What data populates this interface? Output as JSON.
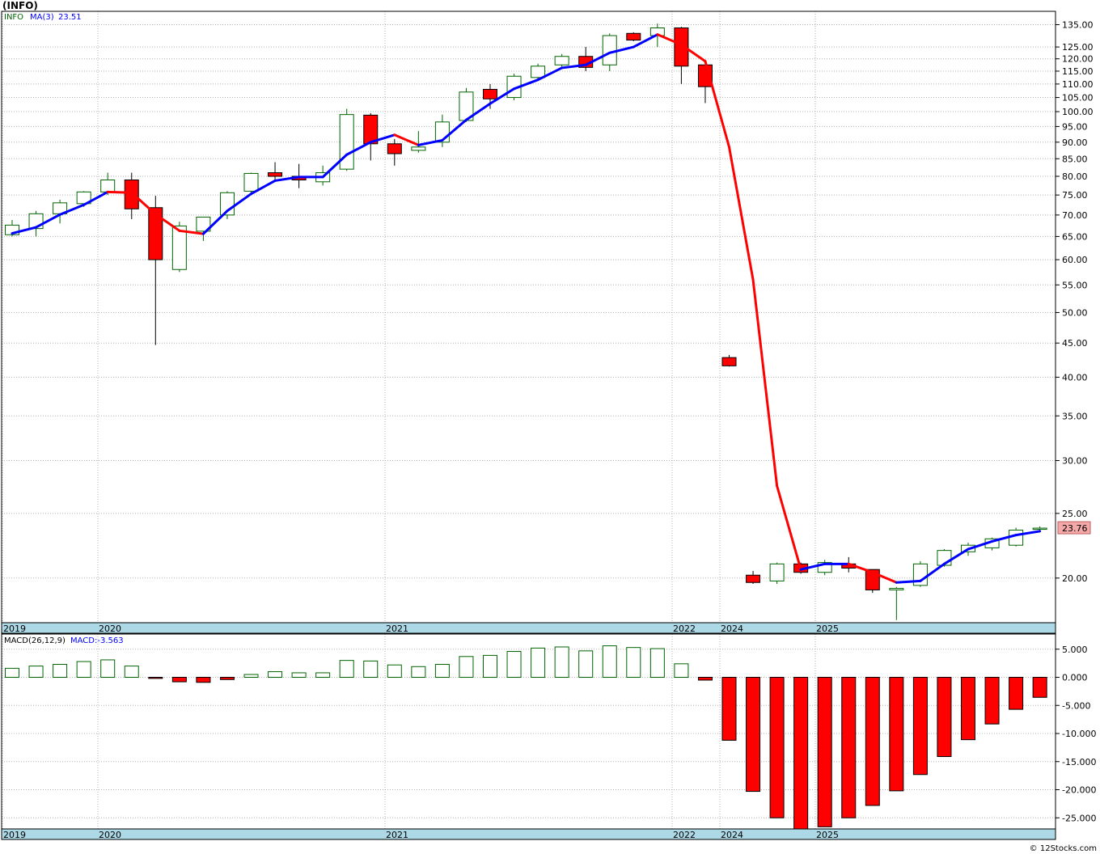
{
  "title": "(INFO)",
  "watermark": "© 12Stocks.com",
  "colors": {
    "up": "#006400",
    "down": "#ff0000",
    "ma_up": "#0000ff",
    "ma_down": "#ff0000",
    "axis_bar": "#add8e6",
    "grid": "#b0b0b0",
    "price_box": "#f4a8a8"
  },
  "chart_data": [
    {
      "type": "candlestick",
      "legend": {
        "symbol": "INFO",
        "ma_label": "MA(3)",
        "ma_value": "23.51"
      },
      "y_scale": "log",
      "ylim": [
        17.3,
        139
      ],
      "y_ticks": [
        "135.00",
        "125.00",
        "120.00",
        "115.00",
        "110.00",
        "105.00",
        "100.00",
        "95.00",
        "90.00",
        "85.00",
        "80.00",
        "75.00",
        "70.00",
        "65.00",
        "60.00",
        "55.00",
        "50.00",
        "45.00",
        "40.00",
        "35.00",
        "30.00",
        "25.00",
        "20.00"
      ],
      "year_labels": [
        "2019",
        "2020",
        "2021",
        "2022",
        "2024",
        "2025"
      ],
      "last_price": "23.76",
      "candles": [
        {
          "o": 65.4,
          "h": 68.8,
          "l": 65.0,
          "c": 67.6
        },
        {
          "o": 66.8,
          "h": 71.0,
          "l": 65.0,
          "c": 70.3
        },
        {
          "o": 70.3,
          "h": 73.8,
          "l": 68.0,
          "c": 73.0
        },
        {
          "o": 72.8,
          "h": 76.0,
          "l": 72.0,
          "c": 75.8
        },
        {
          "o": 75.8,
          "h": 81.0,
          "l": 75.0,
          "c": 79.0
        },
        {
          "o": 79.0,
          "h": 81.0,
          "l": 69.0,
          "c": 71.5
        },
        {
          "o": 71.8,
          "h": 74.8,
          "l": 44.7,
          "c": 60.0
        },
        {
          "o": 58.0,
          "h": 68.4,
          "l": 57.5,
          "c": 67.4
        },
        {
          "o": 66.2,
          "h": 69.5,
          "l": 64.0,
          "c": 69.5
        },
        {
          "o": 70.0,
          "h": 76.0,
          "l": 69.0,
          "c": 75.6
        },
        {
          "o": 76.0,
          "h": 81.0,
          "l": 75.5,
          "c": 80.8
        },
        {
          "o": 81.0,
          "h": 84.0,
          "l": 79.0,
          "c": 80.0
        },
        {
          "o": 80.0,
          "h": 83.5,
          "l": 76.8,
          "c": 79.0
        },
        {
          "o": 78.5,
          "h": 83.0,
          "l": 77.5,
          "c": 81.0
        },
        {
          "o": 82.0,
          "h": 101.0,
          "l": 81.5,
          "c": 99.0
        },
        {
          "o": 98.8,
          "h": 99.5,
          "l": 84.5,
          "c": 89.5
        },
        {
          "o": 89.5,
          "h": 91.0,
          "l": 83.0,
          "c": 86.5
        },
        {
          "o": 87.5,
          "h": 93.5,
          "l": 86.8,
          "c": 88.5
        },
        {
          "o": 90.0,
          "h": 99.0,
          "l": 88.5,
          "c": 96.5
        },
        {
          "o": 97.0,
          "h": 108.5,
          "l": 96.5,
          "c": 107.0
        },
        {
          "o": 108.0,
          "h": 110.0,
          "l": 101.0,
          "c": 104.5
        },
        {
          "o": 105.0,
          "h": 114.0,
          "l": 104.0,
          "c": 113.0
        },
        {
          "o": 112.5,
          "h": 118.0,
          "l": 112.0,
          "c": 117.0
        },
        {
          "o": 117.5,
          "h": 122.0,
          "l": 116.0,
          "c": 121.0
        },
        {
          "o": 121.0,
          "h": 125.0,
          "l": 115.0,
          "c": 116.5
        },
        {
          "o": 117.5,
          "h": 131.0,
          "l": 115.0,
          "c": 130.0
        },
        {
          "o": 131.0,
          "h": 131.5,
          "l": 127.5,
          "c": 128.0
        },
        {
          "o": 130.0,
          "h": 135.5,
          "l": 125.0,
          "c": 133.5
        },
        {
          "o": 133.5,
          "h": 134.0,
          "l": 110.0,
          "c": 117.0
        },
        {
          "o": 117.5,
          "h": 118.5,
          "l": 103.0,
          "c": 109.0
        },
        {
          "o": 42.8,
          "h": 43.2,
          "l": 41.5,
          "c": 41.6
        },
        {
          "o": 20.2,
          "h": 20.5,
          "l": 19.6,
          "c": 19.7
        },
        {
          "o": 19.8,
          "h": 21.1,
          "l": 19.6,
          "c": 21.0
        },
        {
          "o": 21.0,
          "h": 21.1,
          "l": 20.3,
          "c": 20.4
        },
        {
          "o": 20.4,
          "h": 21.3,
          "l": 20.2,
          "c": 21.1
        },
        {
          "o": 21.0,
          "h": 21.5,
          "l": 20.4,
          "c": 20.7
        },
        {
          "o": 20.6,
          "h": 20.6,
          "l": 19.0,
          "c": 19.2
        },
        {
          "o": 19.2,
          "h": 19.4,
          "l": 17.3,
          "c": 19.3
        },
        {
          "o": 19.5,
          "h": 21.2,
          "l": 19.4,
          "c": 21.0
        },
        {
          "o": 20.9,
          "h": 22.1,
          "l": 20.8,
          "c": 22.0
        },
        {
          "o": 21.9,
          "h": 22.6,
          "l": 21.6,
          "c": 22.4
        },
        {
          "o": 22.2,
          "h": 23.0,
          "l": 22.0,
          "c": 22.9
        },
        {
          "o": 22.4,
          "h": 23.8,
          "l": 22.3,
          "c": 23.6
        },
        {
          "o": 23.76,
          "h": 23.9,
          "l": 23.6,
          "c": 23.76
        }
      ],
      "ma": [
        65.7,
        67.1,
        70.1,
        72.5,
        75.8,
        75.6,
        70.2,
        66.3,
        65.6,
        71.0,
        75.3,
        78.8,
        79.8,
        79.8,
        86.2,
        90.0,
        92.3,
        89.1,
        90.6,
        97.2,
        102.8,
        108.2,
        111.6,
        116.3,
        117.5,
        122.5,
        125.0,
        130.5,
        126.0,
        119.0,
        88.5,
        56.0,
        27.5,
        20.6,
        21.0,
        21.0,
        20.4,
        19.7,
        19.8,
        21.0,
        22.1,
        22.7,
        23.2,
        23.51
      ]
    },
    {
      "type": "bar",
      "legend": {
        "label": "MACD(26,12,9)",
        "value_label": "MACD:-3.563"
      },
      "ylim": [
        -27,
        7
      ],
      "y_ticks": [
        "5.000",
        "0.000",
        "-5.000",
        "-10.000",
        "-15.000",
        "-20.000",
        "-25.000"
      ],
      "year_labels": [
        "2019",
        "2020",
        "2021",
        "2022",
        "2024",
        "2025"
      ],
      "values": [
        1.6,
        2.0,
        2.3,
        2.8,
        3.1,
        2.0,
        -0.2,
        -0.8,
        -0.9,
        -0.4,
        0.5,
        1.0,
        0.8,
        0.8,
        3.0,
        2.9,
        2.2,
        1.9,
        2.3,
        3.7,
        3.9,
        4.6,
        5.2,
        5.4,
        4.7,
        5.6,
        5.3,
        5.1,
        2.4,
        -0.5,
        -11.2,
        -20.3,
        -25.0,
        -27.0,
        -26.6,
        -25.0,
        -22.8,
        -20.2,
        -17.3,
        -14.1,
        -11.1,
        -8.3,
        -5.7,
        -3.563
      ]
    }
  ]
}
